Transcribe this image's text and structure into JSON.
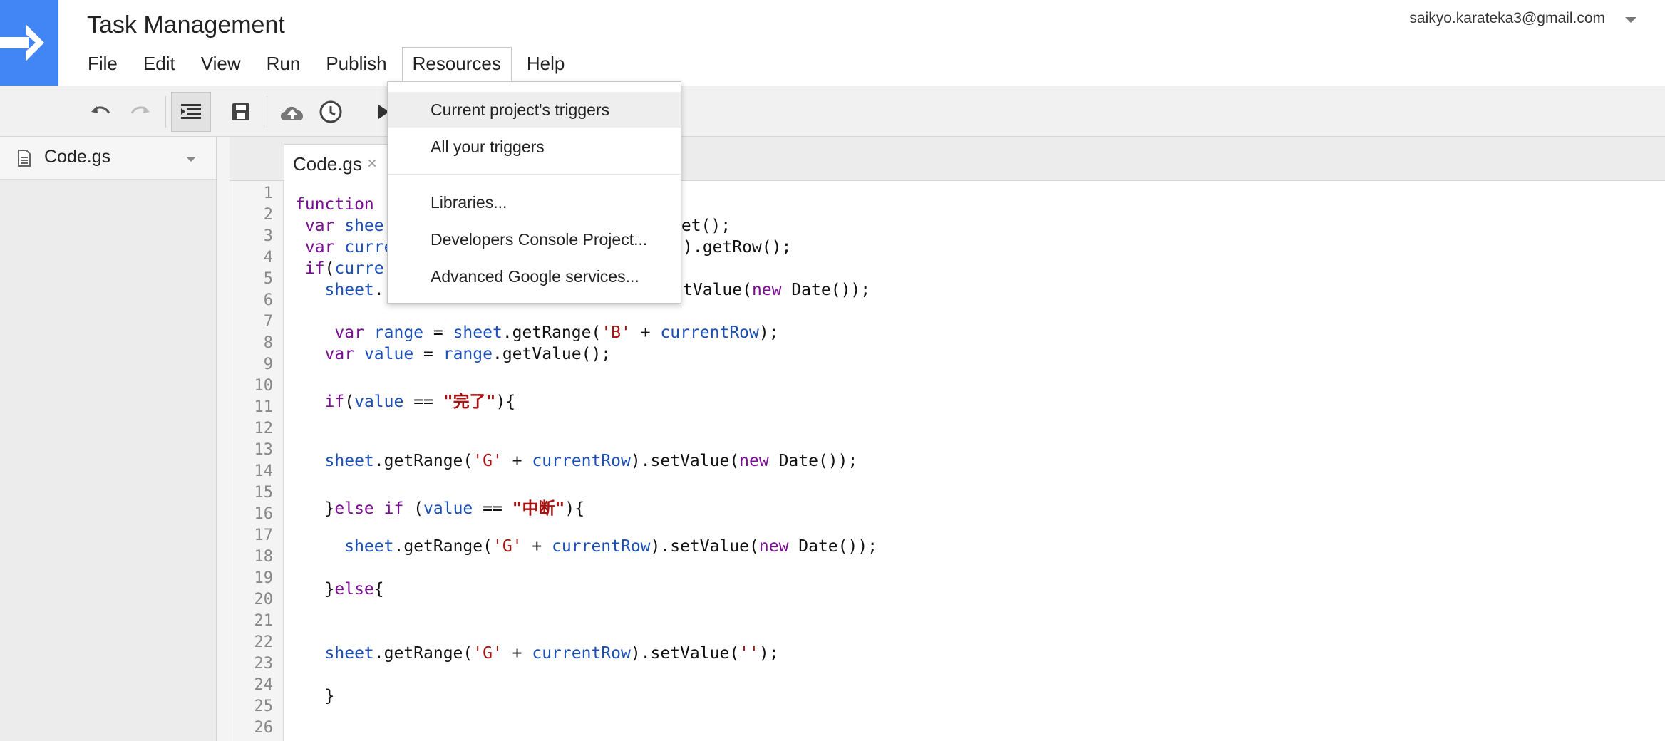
{
  "app": {
    "title": "Task Management",
    "account": "saikyo.karateka3@gmail.com",
    "brand_color": "#4285f4"
  },
  "menubar": {
    "items": [
      {
        "label": "File"
      },
      {
        "label": "Edit"
      },
      {
        "label": "View"
      },
      {
        "label": "Run"
      },
      {
        "label": "Publish"
      },
      {
        "label": "Resources",
        "open": true
      },
      {
        "label": "Help"
      }
    ]
  },
  "toolbar": {
    "icons": [
      "undo-icon",
      "redo-icon",
      "indent-icon",
      "save-icon",
      "cloud-deploy-icon",
      "triggers-clock-icon",
      "run-icon"
    ]
  },
  "resources_menu": {
    "items": [
      {
        "label": "Current project's triggers",
        "highlighted": true
      },
      {
        "label": "All your triggers"
      },
      {
        "label": "Libraries..."
      },
      {
        "label": "Developers Console Project..."
      },
      {
        "label": "Advanced Google services..."
      }
    ]
  },
  "sidebar": {
    "file_name": "Code.gs"
  },
  "editor": {
    "tab_label": "Code.gs",
    "tab_close": "×",
    "line_numbers": [
      "1",
      "2",
      "3",
      "4",
      "5",
      "6",
      "7",
      "8",
      "9",
      "10",
      "11",
      "12",
      "13",
      "14",
      "15",
      "16",
      "17",
      "18",
      "19",
      "20",
      "21",
      "22",
      "23",
      "24",
      "25",
      "26"
    ],
    "lines": {
      "l1": {
        "a": "function"
      },
      "l2": {
        "a": " var",
        "b": " shee",
        "c": "eet();"
      },
      "l3": {
        "a": " var",
        "b": " curre",
        "c": ").getRow();"
      },
      "l4": {
        "a": " if",
        "b": "(",
        "c": "curre"
      },
      "l5": {
        "a": "   sheet",
        "b": ".",
        "c": "tValue(",
        "d": "new",
        "e": " Date());"
      },
      "l7": {
        "a": "    var",
        "b": " range",
        "c": " = ",
        "d": "sheet",
        "e": ".getRange(",
        "f": "'B'",
        "g": " + ",
        "h": "currentRow",
        "i": ");"
      },
      "l8": {
        "a": "   var",
        "b": " value",
        "c": " = ",
        "d": "range",
        "e": ".getValue();"
      },
      "l10": {
        "a": "   if",
        "b": "(",
        "c": "value",
        "d": " == ",
        "e": "\"完了\"",
        "f": "){"
      },
      "l13": {
        "a": "   sheet",
        "b": ".getRange(",
        "c": "'G'",
        "d": " + ",
        "e": "currentRow",
        "f": ").setValue(",
        "g": "new",
        "h": " Date());"
      },
      "l15": {
        "a": "   }",
        "b": "else if",
        "c": " (",
        "d": "value",
        "e": " == ",
        "f": "\"中断\"",
        "g": "){"
      },
      "l17": {
        "a": "     sheet",
        "b": ".getRange(",
        "c": "'G'",
        "d": " + ",
        "e": "currentRow",
        "f": ").setValue(",
        "g": "new",
        "h": " Date());"
      },
      "l19": {
        "a": "   }",
        "b": "else",
        "c": "{"
      },
      "l22": {
        "a": "   sheet",
        "b": ".getRange(",
        "c": "'G'",
        "d": " + ",
        "e": "currentRow",
        "f": ").setValue(",
        "g": "''",
        "h": ");"
      },
      "l24": {
        "a": "   }"
      }
    }
  }
}
